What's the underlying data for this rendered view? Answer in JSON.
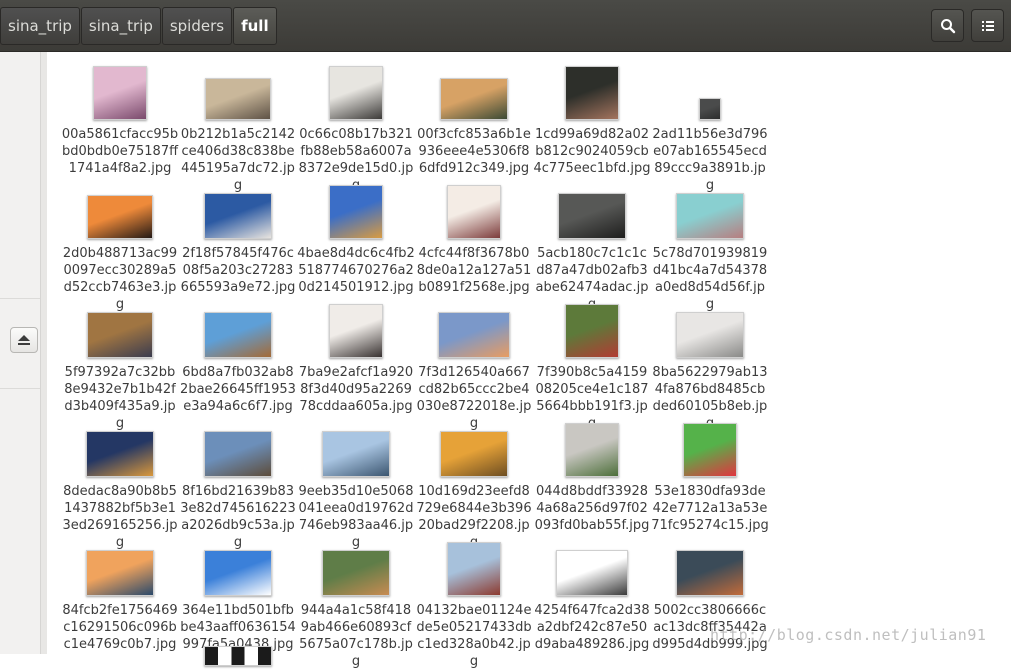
{
  "breadcrumbs": [
    "sina_trip",
    "sina_trip",
    "spiders",
    "full"
  ],
  "header": {
    "search_icon": "search-icon",
    "view_icon": "list-view-icon"
  },
  "sidebar": {
    "eject_icon": "eject-icon"
  },
  "files": [
    {
      "name": "00a5861cfacc95bbd0bdb0e75187ff1741a4f8a2.jpg",
      "thumb": [
        "#e2b8cf",
        "#7a4a6c"
      ]
    },
    {
      "name": "0b212b1a5c2142ce406d38c838be445195a7dc72.jpg",
      "thumb": [
        "#c9b79a",
        "#5e5246"
      ]
    },
    {
      "name": "0c66c08b17b321fb88eb58a6007a8372e9de15d0.jpg",
      "thumb": [
        "#e7e5e0",
        "#3c3a38"
      ]
    },
    {
      "name": "00f3cfc853a6b1e936eee4e5306f86dfd912c349.jpg",
      "thumb": [
        "#d7a265",
        "#3b4a35"
      ]
    },
    {
      "name": "1cd99a69d82a02b812c9024059cb4c775eec1bfd.jpg",
      "thumb": [
        "#2d2f2a",
        "#a4745e"
      ]
    },
    {
      "name": "2ad11b56e3d796e07ab165545ecd89ccc9a3891b.jpg",
      "thumb": [
        "#4a4b4b",
        "#2c2d2d"
      ]
    },
    {
      "name": "2d0b488713ac990097ecc30289a5d52ccb7463e3.jpg",
      "thumb": [
        "#ee8a3a",
        "#241a16"
      ]
    },
    {
      "name": "2f18f57845f476c08f5a203c27283665593a9e72.jpg",
      "thumb": [
        "#2c5aa3",
        "#e8e4df"
      ]
    },
    {
      "name": "4bae8d4dc6c4fb2518774670276a20d214501912.jpg",
      "thumb": [
        "#3b6ec7",
        "#d89b42"
      ]
    },
    {
      "name": "4cfc44f8f3678b08de0a12a127a51b0891f2568e.jpg",
      "thumb": [
        "#f4ece5",
        "#7c3b3b"
      ]
    },
    {
      "name": "5acb180c7c1c1cd87a47db02afb3abe62474adac.jpg",
      "thumb": [
        "#575856",
        "#1e1e1d"
      ]
    },
    {
      "name": "5c78d701939819d41bc4a7d54378a0ed8d54d56f.jpg",
      "thumb": [
        "#89cfd0",
        "#b77e80"
      ]
    },
    {
      "name": "5f97392a7c32bb8e9432e7b1b42fd3b409f435a9.jpg",
      "thumb": [
        "#a07542",
        "#3b3c4f"
      ]
    },
    {
      "name": "6bd8a7fb032ab82bae26645ff1953e3a94a6c6f7.jpg",
      "thumb": [
        "#5e9fd7",
        "#a46a36"
      ]
    },
    {
      "name": "7ba9e2afcf1a9208f3d40d95a226978cddaa605a.jpg",
      "thumb": [
        "#f0ece8",
        "#383231"
      ]
    },
    {
      "name": "7f3d126540a667cd82b65ccc2be4030e8722018e.jpg",
      "thumb": [
        "#7b98c9",
        "#e89c62"
      ]
    },
    {
      "name": "7f390b8c5a415908205ce4e1c1875664bbb191f3.jpg",
      "thumb": [
        "#5d7a3a",
        "#b23b33"
      ]
    },
    {
      "name": "8ba5622979ab134fa876bd8485cbded60105b8eb.jpg",
      "thumb": [
        "#e8e6e4",
        "#8a8a88"
      ]
    },
    {
      "name": "8dedac8a90b8b51437882bf5b3e13ed269165256.jpg",
      "thumb": [
        "#243764",
        "#d9983c"
      ]
    },
    {
      "name": "8f16bd21639b833e82d745616223a2026db9c53a.jpg",
      "thumb": [
        "#6c8fba",
        "#5d4c3a"
      ]
    },
    {
      "name": "9eeb35d10e5068041eea0d19762d746eb983aa46.jpg",
      "thumb": [
        "#a9c5e2",
        "#3c5670"
      ]
    },
    {
      "name": "10d169d23eefd8729e6844e3b39620bad29f2208.jpg",
      "thumb": [
        "#e6a238",
        "#6e4e22"
      ]
    },
    {
      "name": "044d8bddf339284a68a256d97f02093fd0bab55f.jpg",
      "thumb": [
        "#c9c7c2",
        "#4d6f3a"
      ]
    },
    {
      "name": "53e1830dfa93de42e7712a13a53e71fc95274c15.jpg",
      "thumb": [
        "#55b24a",
        "#e1353f"
      ]
    },
    {
      "name": "84fcb2fe1756469c16291506c096bc1e4769c0b7.jpg",
      "thumb": [
        "#f0a35d",
        "#2b4a6b"
      ]
    },
    {
      "name": "364e11bd501bfbbe43aaff0636154997fa5a0438.jpg",
      "thumb": [
        "#3b80d9",
        "#ffffff"
      ]
    },
    {
      "name": "944a4a1c58f4189ab466e60893cf5675a07c178b.jpg",
      "thumb": [
        "#5f7d48",
        "#c88b52"
      ]
    },
    {
      "name": "04132bae01124ede5e05217433dbc1ed328a0b42.jpg",
      "thumb": [
        "#a7c1db",
        "#8c3a2f"
      ]
    },
    {
      "name": "4254f647fca2d38a2dbf242c87e50d9aba489286.jpg",
      "thumb": [
        "#ffffff",
        "#3a3a3a"
      ]
    },
    {
      "name": "5002cc3806666cac13dc8ff35442ad995d4db999.jpg",
      "thumb": [
        "#3b4b58",
        "#c26b3a"
      ]
    }
  ],
  "watermark": "http://blog.csdn.net/julian91"
}
